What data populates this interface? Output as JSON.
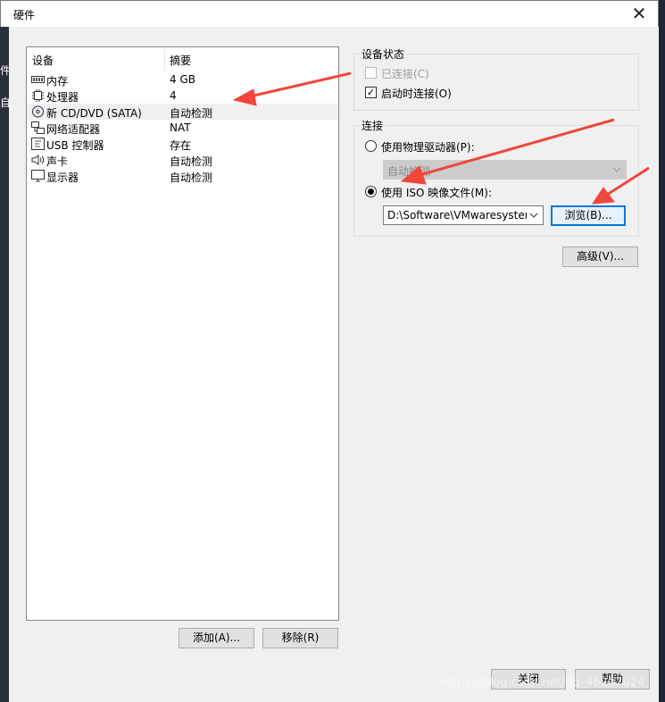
{
  "window": {
    "title": "硬件",
    "close_glyph": "✕"
  },
  "edge_left": [
    "件",
    "自"
  ],
  "devices": {
    "col_device": "设备",
    "col_summary": "摘要",
    "rows": [
      {
        "icon": "memory-icon",
        "name": "内存",
        "summary": "4 GB"
      },
      {
        "icon": "processor-icon",
        "name": "处理器",
        "summary": "4"
      },
      {
        "icon": "cd-dvd-icon",
        "name": "新 CD/DVD (SATA)",
        "summary": "自动检测"
      },
      {
        "icon": "network-adapter-icon",
        "name": "网络适配器",
        "summary": "NAT"
      },
      {
        "icon": "usb-controller-icon",
        "name": "USB 控制器",
        "summary": "存在"
      },
      {
        "icon": "sound-card-icon",
        "name": "声卡",
        "summary": "自动检测"
      },
      {
        "icon": "display-icon",
        "name": "显示器",
        "summary": "自动检测"
      }
    ],
    "selected_index": 2
  },
  "buttons": {
    "add": "添加(A)...",
    "remove": "移除(R)",
    "browse": "浏览(B)...",
    "advanced": "高级(V)...",
    "close": "关闭",
    "help": "帮助"
  },
  "device_status": {
    "title": "设备状态",
    "connected": {
      "label": "已连接(C)",
      "checked": false,
      "enabled": false
    },
    "connect_at_power_on": {
      "label": "启动时连接(O)",
      "checked": true,
      "enabled": true
    }
  },
  "connection": {
    "title": "连接",
    "physical": {
      "label": "使用物理驱动器(P):",
      "selected": false,
      "combo_value": "自动检测"
    },
    "iso": {
      "label": "使用 ISO 映像文件(M):",
      "selected": true,
      "path": "D:\\Software\\VMwaresystem"
    }
  },
  "watermark": "https://blog.csdn.net/qq_46207024",
  "colors": {
    "annotation": "#f0463c",
    "focus": "#0078d7"
  }
}
